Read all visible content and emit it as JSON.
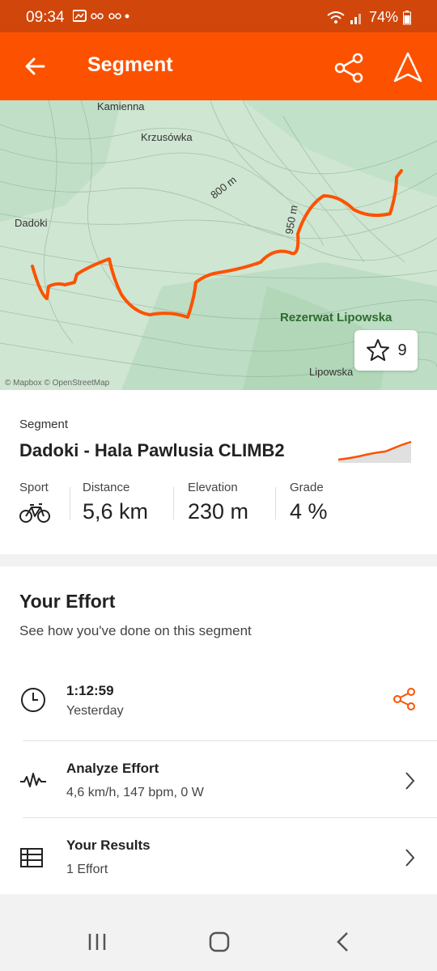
{
  "status_bar": {
    "time": "09:34",
    "battery": "74%"
  },
  "app_bar": {
    "title": "Segment"
  },
  "map": {
    "labels": {
      "kamienna": "Kamienna",
      "krzusowka": "Krzusówka",
      "contour_800": "800 m",
      "contour_950": "950 m",
      "dadoki": "Dadoki",
      "rezerwat": "Rezerwat Lipowska",
      "lipowska": "Lipowska"
    },
    "attribution": "© Mapbox © OpenStreetMap",
    "star_count": "9",
    "route_color": "#fc5200"
  },
  "segment": {
    "label": "Segment",
    "name": "Dadoki - Hala Pawlusia CLIMB2",
    "stats": {
      "sport_label": "Sport",
      "distance_label": "Distance",
      "distance_value": "5,6 km",
      "elevation_label": "Elevation",
      "elevation_value": "230 m",
      "grade_label": "Grade",
      "grade_value": "4 %"
    }
  },
  "effort": {
    "title": "Your Effort",
    "subtitle": "See how you've done on this segment",
    "time_row": {
      "time": "1:12:59",
      "when": "Yesterday"
    },
    "analyze_row": {
      "title": "Analyze Effort",
      "detail": "4,6 km/h, 147 bpm, 0 W"
    },
    "results_row": {
      "title": "Your Results",
      "detail": "1 Effort"
    }
  },
  "colors": {
    "accent": "#fc5200",
    "status_bar": "#d0460b"
  }
}
